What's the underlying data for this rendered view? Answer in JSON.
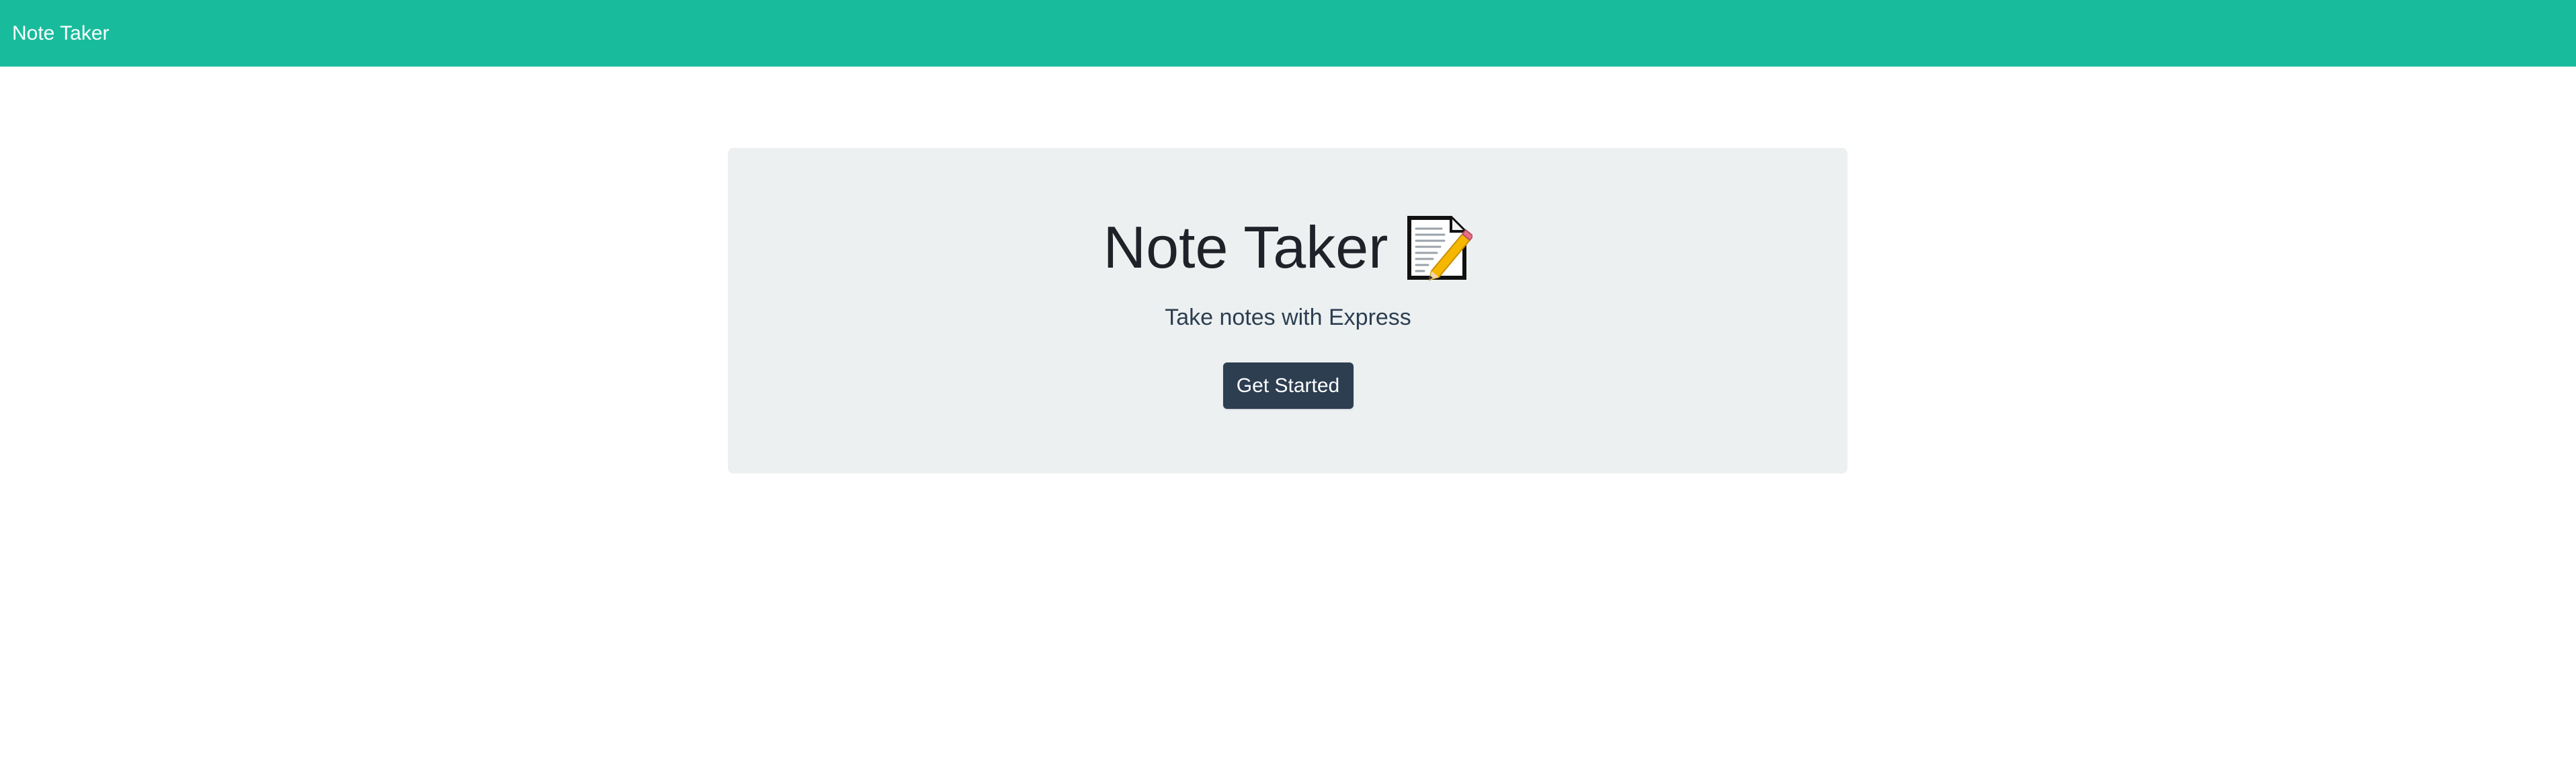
{
  "navbar": {
    "brand": "Note Taker",
    "background_color": "#18bc9c"
  },
  "hero": {
    "title": "Note Taker",
    "title_icon": "memo-icon",
    "subtitle": "Take notes with Express",
    "button_label": "Get Started",
    "background_color": "#ecf0f1",
    "button_color": "#2c3e50"
  }
}
